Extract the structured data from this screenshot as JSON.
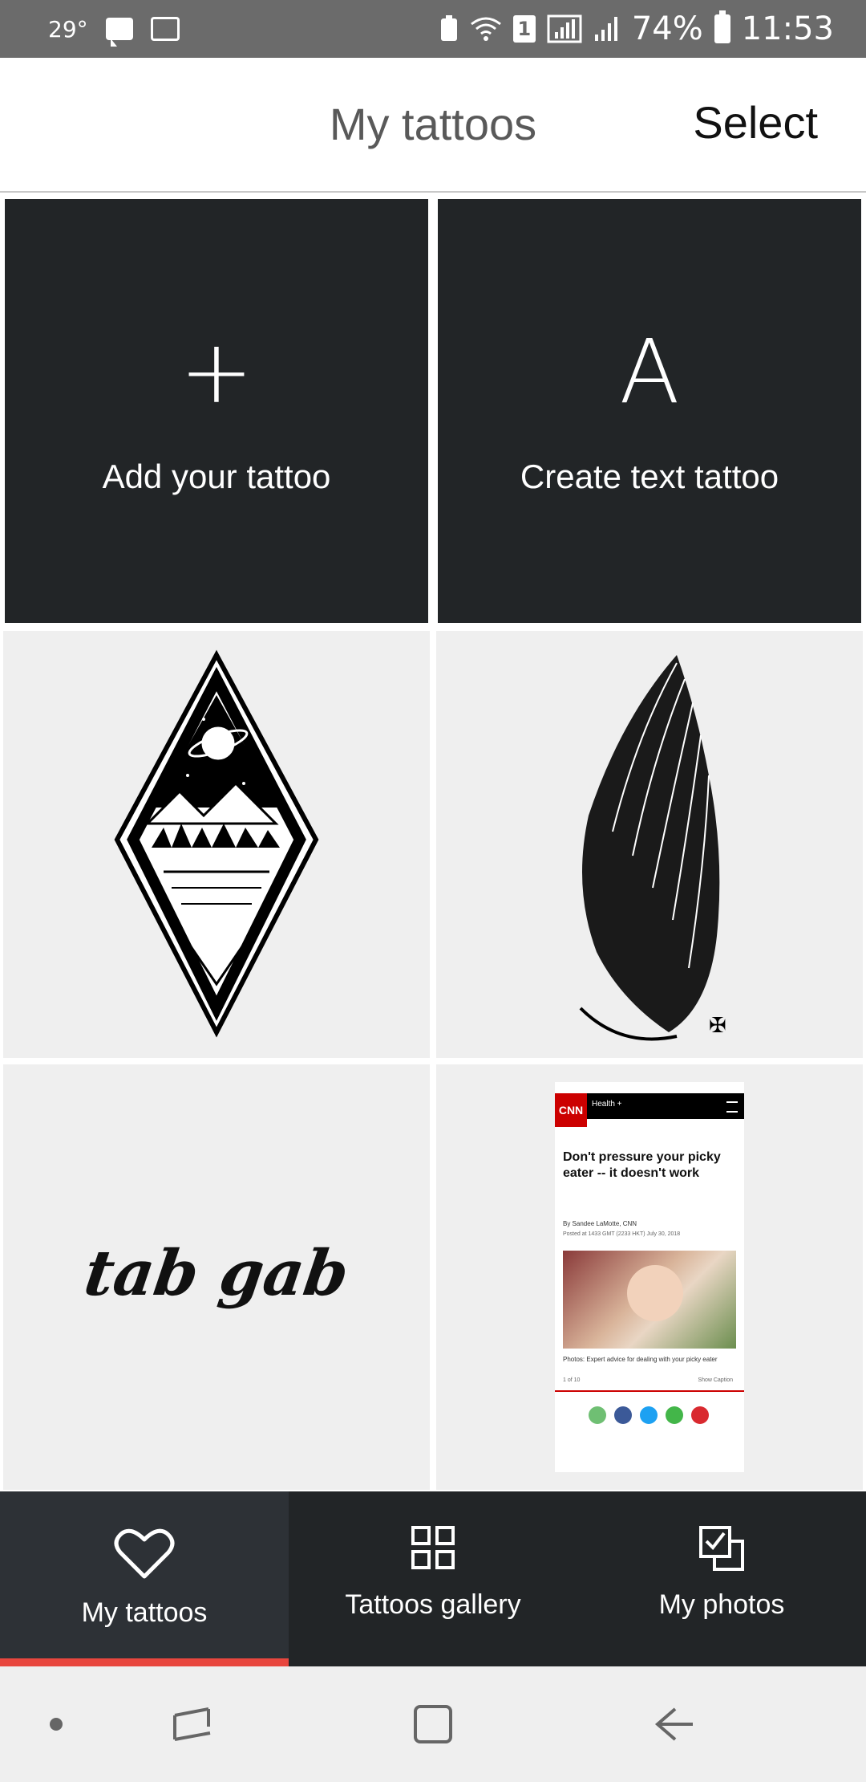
{
  "status_bar": {
    "temperature": "29°",
    "battery": "74%",
    "time": "11:53",
    "sim_slot": "1"
  },
  "header": {
    "title": "My tattoos",
    "select_label": "Select"
  },
  "grid": {
    "add_tile": {
      "icon": "+",
      "label": "Add your tattoo"
    },
    "text_tile": {
      "icon": "A",
      "label": "Create text tattoo"
    },
    "text_tattoo_sample": "tab gab",
    "screenshot_tile": {
      "cnn_logo": "CNN",
      "section": "Health +",
      "headline": "Don't pressure your picky eater -- it doesn't work",
      "byline": "By Sandee LaMotte, CNN",
      "posted": "Posted at 1433 GMT (2233 HKT) July 30, 2018",
      "caption": "Photos: Expert advice for dealing with your picky eater",
      "counter": "1 of 10",
      "show_caption": "Show Caption"
    }
  },
  "bottom_nav": {
    "items": [
      {
        "label": "My tattoos",
        "icon": "heart-icon"
      },
      {
        "label": "Tattoos gallery",
        "icon": "grid-icon"
      },
      {
        "label": "My photos",
        "icon": "photos-icon"
      }
    ],
    "active_index": 0
  },
  "colors": {
    "dark_tile": "#222527",
    "light_tile": "#efefef",
    "accent": "#e8463e",
    "status_bar": "#6b6b6b"
  }
}
